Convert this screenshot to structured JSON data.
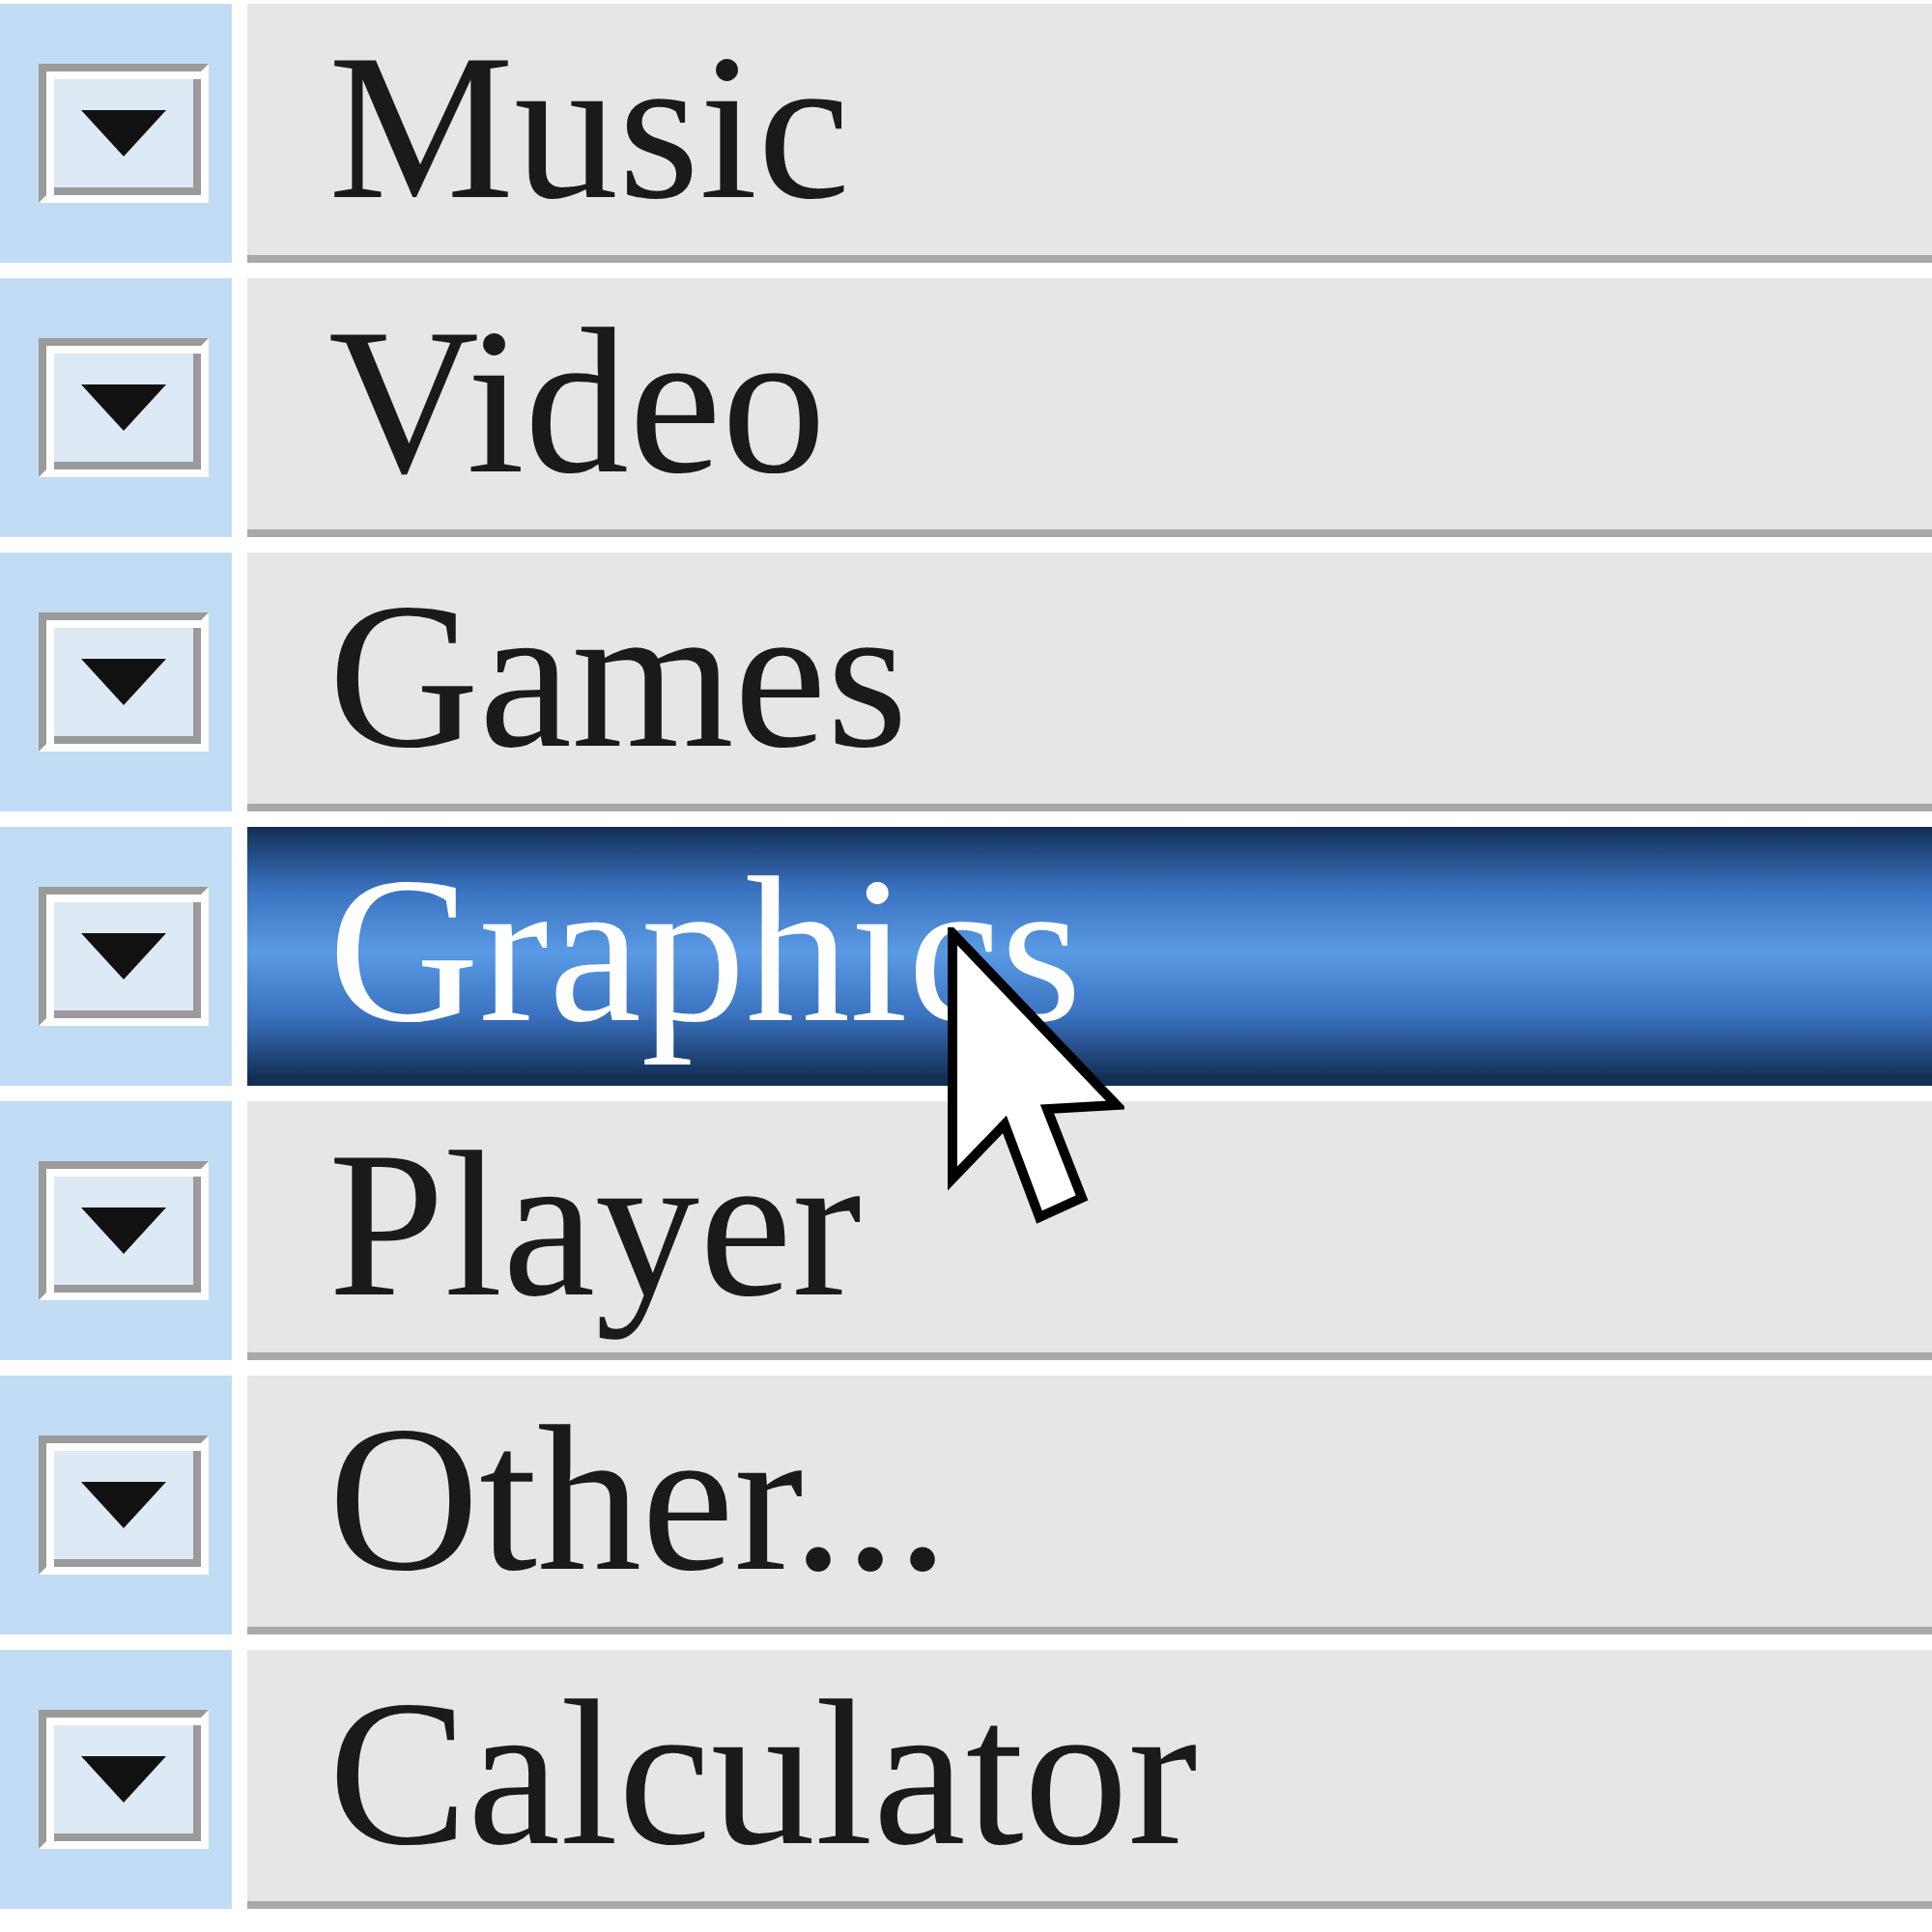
{
  "menu": {
    "items": [
      {
        "label": "Music",
        "selected": false
      },
      {
        "label": "Video",
        "selected": false
      },
      {
        "label": "Games",
        "selected": false
      },
      {
        "label": "Graphics",
        "selected": true
      },
      {
        "label": "Player",
        "selected": false
      },
      {
        "label": "Other...",
        "selected": false
      },
      {
        "label": "Calculator",
        "selected": false
      }
    ]
  }
}
